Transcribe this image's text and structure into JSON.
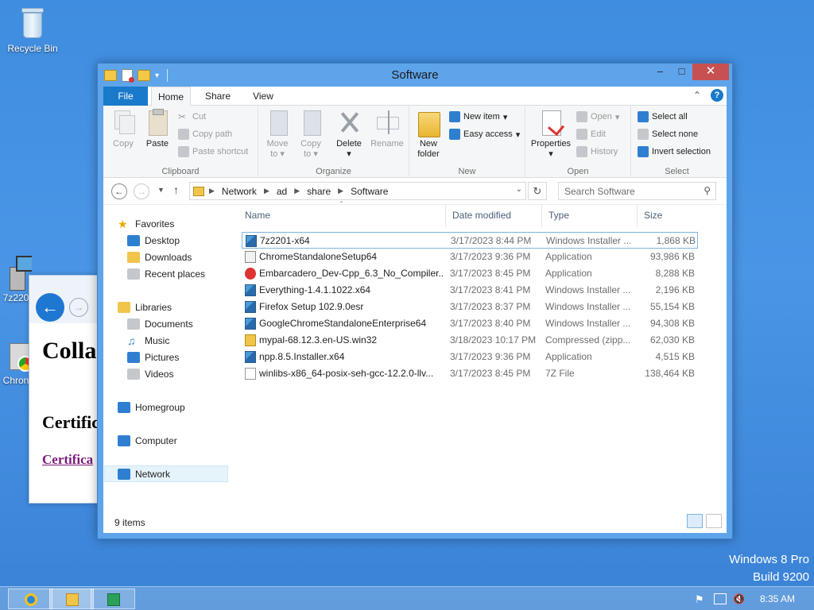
{
  "desktop": {
    "recycle_label": "Recycle Bin",
    "icon1_label": "7z220",
    "icon2_label": "Chron",
    "watermark_line1": "Windows 8 Pro",
    "watermark_line2": "Build 9200"
  },
  "bg_browser": {
    "h1": "Colla",
    "h2": "Certific",
    "link": "Certifica"
  },
  "window": {
    "title": "Software",
    "ribbon_tabs": [
      "File",
      "Home",
      "Share",
      "View"
    ],
    "ribbon": {
      "clipboard": {
        "label": "Clipboard",
        "copy": "Copy",
        "paste": "Paste",
        "cut": "Cut",
        "copy_path": "Copy path",
        "paste_shortcut": "Paste shortcut"
      },
      "organize": {
        "label": "Organize",
        "move_to_1": "Move",
        "move_to_2": "to",
        "copy_to_1": "Copy",
        "copy_to_2": "to",
        "delete": "Delete",
        "rename": "Rename"
      },
      "new": {
        "label": "New",
        "new_folder_1": "New",
        "new_folder_2": "folder",
        "new_item": "New item",
        "easy_access": "Easy access"
      },
      "open": {
        "label": "Open",
        "properties": "Properties",
        "open": "Open",
        "edit": "Edit",
        "history": "History"
      },
      "select": {
        "label": "Select",
        "select_all": "Select all",
        "select_none": "Select none",
        "invert_selection": "Invert selection"
      }
    },
    "address": {
      "crumbs": [
        "Network",
        "ad",
        "share",
        "Software"
      ],
      "search_placeholder": "Search Software"
    },
    "nav": {
      "favorites": "Favorites",
      "desktop": "Desktop",
      "downloads": "Downloads",
      "recent": "Recent places",
      "libraries": "Libraries",
      "documents": "Documents",
      "music": "Music",
      "pictures": "Pictures",
      "videos": "Videos",
      "homegroup": "Homegroup",
      "computer": "Computer",
      "network": "Network"
    },
    "columns": {
      "name": "Name",
      "date": "Date modified",
      "type": "Type",
      "size": "Size"
    },
    "files": [
      {
        "name": "7z2201-x64",
        "date": "3/17/2023 8:44 PM",
        "type": "Windows Installer ...",
        "size": "1,868 KB",
        "icon": "installer-icon"
      },
      {
        "name": "ChromeStandaloneSetup64",
        "date": "3/17/2023 9:36 PM",
        "type": "Application",
        "size": "93,986 KB",
        "icon": "application-icon"
      },
      {
        "name": "Embarcadero_Dev-Cpp_6.3_No_Compiler...",
        "date": "3/17/2023 8:45 PM",
        "type": "Application",
        "size": "8,288 KB",
        "icon": "devcpp-icon"
      },
      {
        "name": "Everything-1.4.1.1022.x64",
        "date": "3/17/2023 8:41 PM",
        "type": "Windows Installer ...",
        "size": "2,196 KB",
        "icon": "installer-icon"
      },
      {
        "name": "Firefox Setup 102.9.0esr",
        "date": "3/17/2023 8:37 PM",
        "type": "Windows Installer ...",
        "size": "55,154 KB",
        "icon": "installer-icon"
      },
      {
        "name": "GoogleChromeStandaloneEnterprise64",
        "date": "3/17/2023 8:40 PM",
        "type": "Windows Installer ...",
        "size": "94,308 KB",
        "icon": "installer-icon"
      },
      {
        "name": "mypal-68.12.3.en-US.win32",
        "date": "3/18/2023 10:17 PM",
        "type": "Compressed (zipp...",
        "size": "62,030 KB",
        "icon": "zip-icon"
      },
      {
        "name": "npp.8.5.Installer.x64",
        "date": "3/17/2023 9:36 PM",
        "type": "Application",
        "size": "4,515 KB",
        "icon": "installer-icon"
      },
      {
        "name": "winlibs-x86_64-posix-seh-gcc-12.2.0-llv...",
        "date": "3/17/2023 8:45 PM",
        "type": "7Z File",
        "size": "138,464 KB",
        "icon": "7z-file-icon"
      }
    ],
    "status": "9 items"
  },
  "taskbar": {
    "clock": "8:35 AM"
  }
}
